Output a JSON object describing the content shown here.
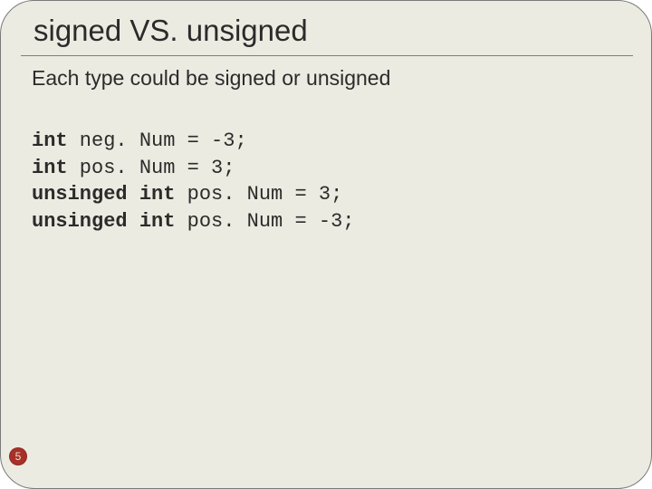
{
  "slide": {
    "title": "signed VS. unsigned",
    "subtitle": "Each type could be signed or unsigned",
    "page_number": "5"
  },
  "code": {
    "lines": [
      {
        "kw": "int",
        "rest": " neg. Num = -3;"
      },
      {
        "kw": "int",
        "rest": " pos. Num = 3;"
      },
      {
        "kw": "unsinged",
        "mid": " int",
        "rest": " pos. Num = 3;"
      },
      {
        "kw": "unsinged",
        "mid": " int",
        "rest": " pos. Num = -3;"
      }
    ]
  }
}
